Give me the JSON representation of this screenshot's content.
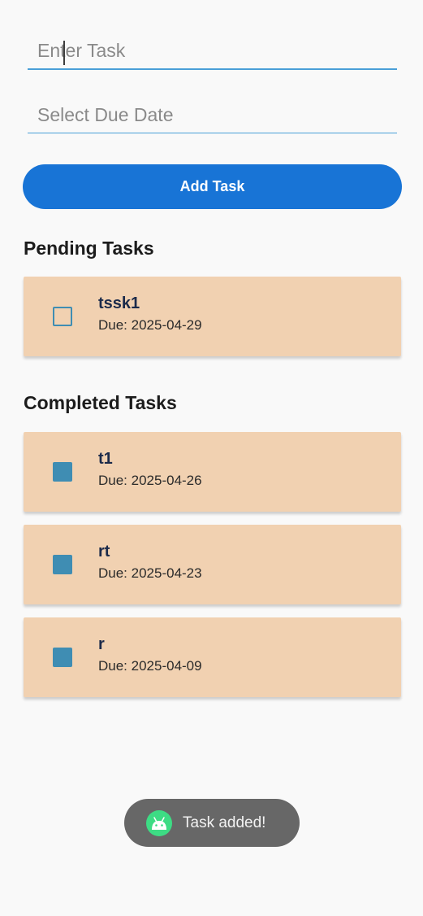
{
  "form": {
    "task_placeholder": "Enter Task",
    "date_placeholder": "Select Due Date",
    "add_button_label": "Add Task"
  },
  "sections": {
    "pending_title": "Pending Tasks",
    "completed_title": "Completed Tasks"
  },
  "pending_tasks": [
    {
      "name": "tssk1",
      "due": "Due: 2025-04-29",
      "checked": false
    }
  ],
  "completed_tasks": [
    {
      "name": "t1",
      "due": "Due: 2025-04-26",
      "checked": true
    },
    {
      "name": "rt",
      "due": "Due: 2025-04-23",
      "checked": true
    },
    {
      "name": "r",
      "due": "Due: 2025-04-09",
      "checked": true
    }
  ],
  "toast": {
    "message": "Task added!",
    "icon": "android-icon"
  },
  "colors": {
    "accent": "#1874d6",
    "card_background": "#f1d1b1",
    "checkbox": "#3f8db3",
    "toast_background": "#676767",
    "android_green": "#3ddc84"
  }
}
